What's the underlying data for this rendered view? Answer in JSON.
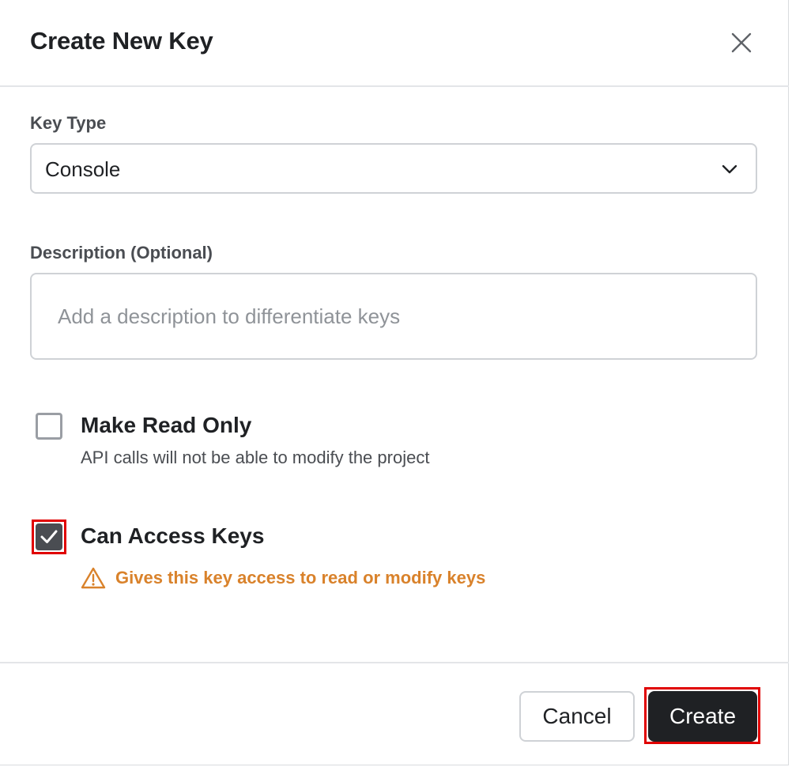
{
  "dialog": {
    "title": "Create New Key",
    "close_icon": "close-icon"
  },
  "key_type": {
    "label": "Key Type",
    "selected": "Console",
    "chevron_icon": "chevron-down-icon"
  },
  "description": {
    "label": "Description (Optional)",
    "value": "",
    "placeholder": "Add a description to differentiate keys"
  },
  "read_only": {
    "label": "Make Read Only",
    "description": "API calls will not be able to modify the project",
    "checked": false
  },
  "access_keys": {
    "label": "Can Access Keys",
    "checked": true,
    "warning": "Gives this key access to read or modify keys",
    "warning_icon": "warning-icon",
    "warning_color": "#d9822b"
  },
  "footer": {
    "cancel_label": "Cancel",
    "create_label": "Create"
  },
  "colors": {
    "primary_button": "#1f2124",
    "checkbox_checked": "#4a4d52",
    "highlight": "#e00000"
  }
}
